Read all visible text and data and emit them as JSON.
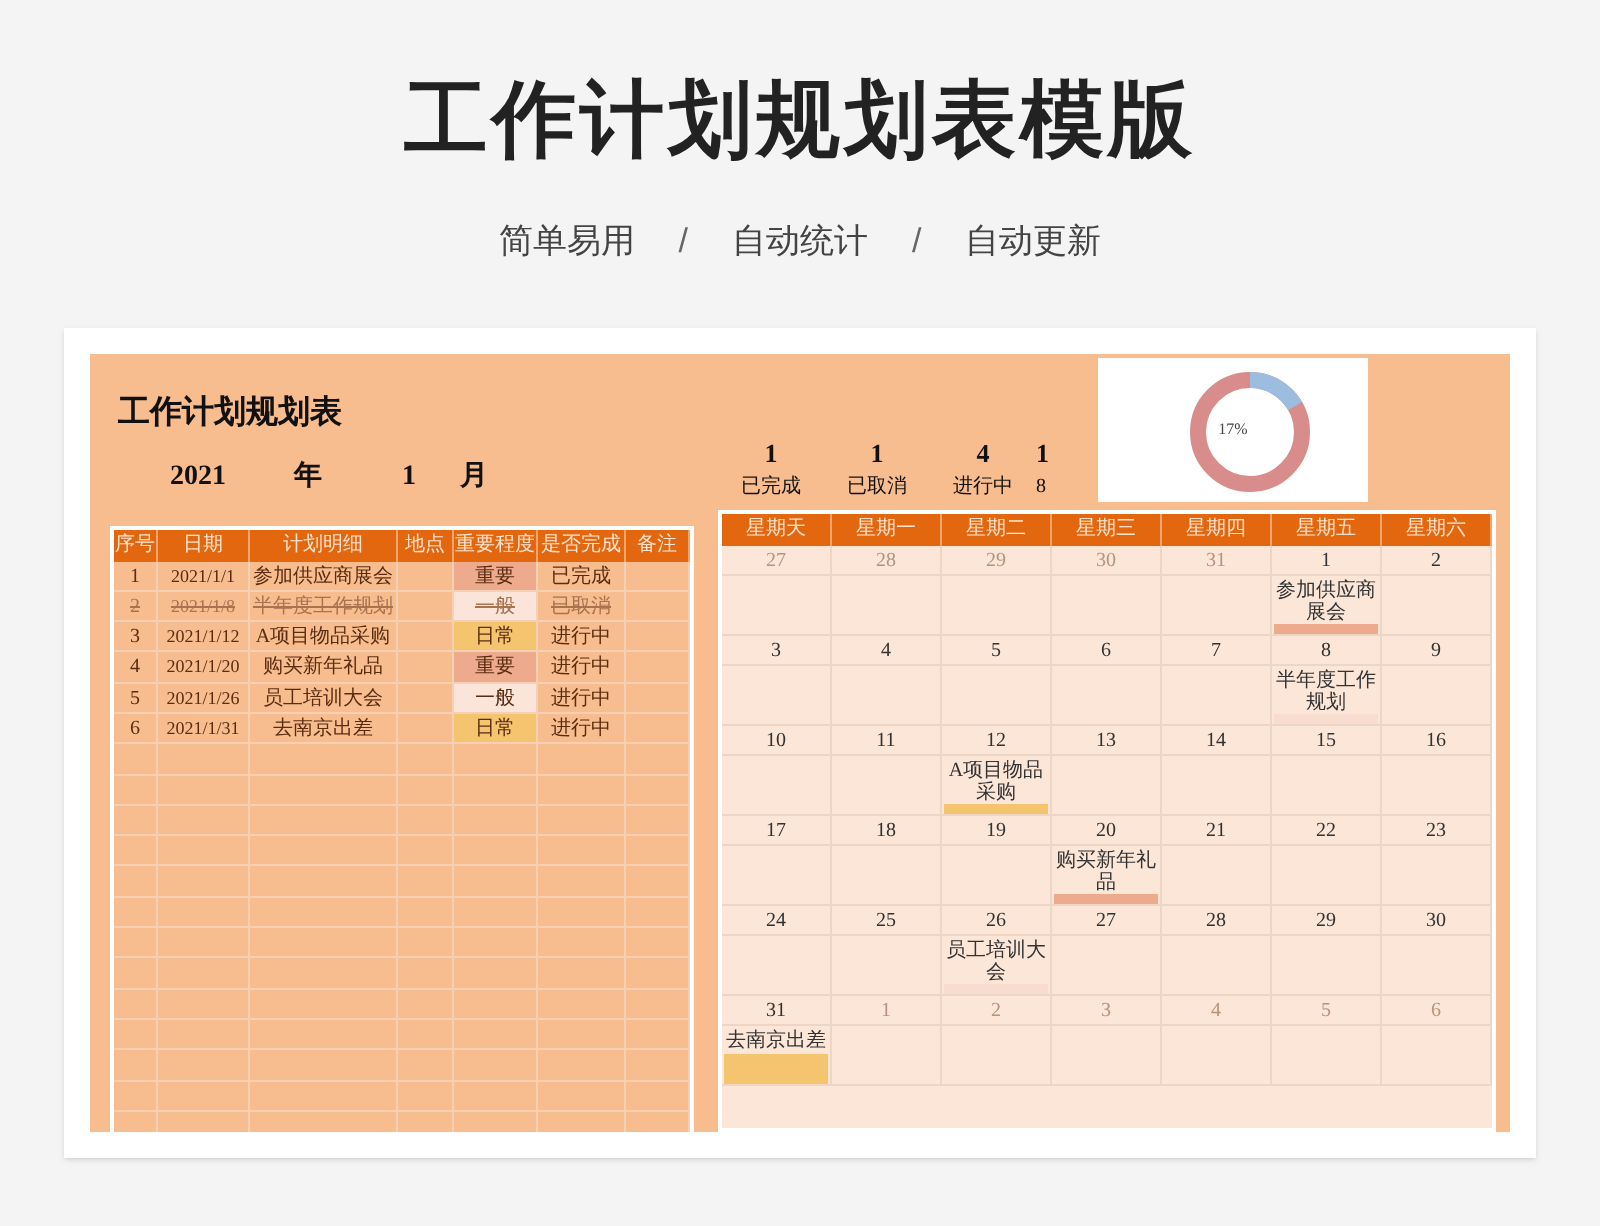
{
  "title": "工作计划规划表模版",
  "tags": [
    "简单易用",
    "/",
    "自动统计",
    "/",
    "自动更新"
  ],
  "sheet": {
    "title": "工作计划规划表",
    "year": "2021",
    "year_unit": "年",
    "month": "1",
    "month_unit": "月",
    "stats": [
      {
        "value": "1",
        "label": "已完成"
      },
      {
        "value": "1",
        "label": "已取消"
      },
      {
        "value": "4",
        "label": "进行中"
      },
      {
        "value": "1",
        "label": "8"
      }
    ],
    "donut_label": "17%",
    "table": {
      "columns": [
        "序号",
        "日期",
        "计划明细",
        "地点",
        "重要程度",
        "是否完成",
        "备注"
      ],
      "rows": [
        {
          "no": "1",
          "date": "2021/1/1",
          "task": "参加供应商展会",
          "importance": "重要",
          "color": "#eeaa8c",
          "status": "已完成",
          "cancelled": false
        },
        {
          "no": "2",
          "date": "2021/1/8",
          "task": "半年度工作规划",
          "importance": "一般",
          "color": "#fbe4da",
          "status": "已取消",
          "cancelled": true
        },
        {
          "no": "3",
          "date": "2021/1/12",
          "task": "A项目物品采购",
          "importance": "日常",
          "color": "#f4c46e",
          "status": "进行中",
          "cancelled": false
        },
        {
          "no": "4",
          "date": "2021/1/20",
          "task": "购买新年礼品",
          "importance": "重要",
          "color": "#eeaa8c",
          "status": "进行中",
          "cancelled": false
        },
        {
          "no": "5",
          "date": "2021/1/26",
          "task": "员工培训大会",
          "importance": "一般",
          "color": "#fbe4da",
          "status": "进行中",
          "cancelled": false
        },
        {
          "no": "6",
          "date": "2021/1/31",
          "task": "去南京出差",
          "importance": "日常",
          "color": "#f4c46e",
          "status": "进行中",
          "cancelled": false
        }
      ]
    },
    "calendar": {
      "weekdays": [
        "星期天",
        "星期一",
        "星期二",
        "星期三",
        "星期四",
        "星期五",
        "星期六"
      ],
      "weeks": [
        [
          {
            "day": "27",
            "muted": true
          },
          {
            "day": "28",
            "muted": true
          },
          {
            "day": "29",
            "muted": true
          },
          {
            "day": "30",
            "muted": true
          },
          {
            "day": "31",
            "muted": true
          },
          {
            "day": "1",
            "muted": false,
            "event": "参加供应商展会",
            "color": "#eeaa8c"
          },
          {
            "day": "2",
            "muted": false
          }
        ],
        [
          {
            "day": "3",
            "muted": false
          },
          {
            "day": "4",
            "muted": false
          },
          {
            "day": "5",
            "muted": false
          },
          {
            "day": "6",
            "muted": false
          },
          {
            "day": "7",
            "muted": false
          },
          {
            "day": "8",
            "muted": false,
            "event": "半年度工作规划",
            "color": "#f8dccf"
          },
          {
            "day": "9",
            "muted": false
          }
        ],
        [
          {
            "day": "10",
            "muted": false
          },
          {
            "day": "11",
            "muted": false
          },
          {
            "day": "12",
            "muted": false,
            "event": "A项目物品采购",
            "color": "#f4c46e"
          },
          {
            "day": "13",
            "muted": false
          },
          {
            "day": "14",
            "muted": false
          },
          {
            "day": "15",
            "muted": false
          },
          {
            "day": "16",
            "muted": false
          }
        ],
        [
          {
            "day": "17",
            "muted": false
          },
          {
            "day": "18",
            "muted": false
          },
          {
            "day": "19",
            "muted": false
          },
          {
            "day": "20",
            "muted": false,
            "event": "购买新年礼品",
            "color": "#eeaa8c"
          },
          {
            "day": "21",
            "muted": false
          },
          {
            "day": "22",
            "muted": false
          },
          {
            "day": "23",
            "muted": false
          }
        ],
        [
          {
            "day": "24",
            "muted": false
          },
          {
            "day": "25",
            "muted": false
          },
          {
            "day": "26",
            "muted": false,
            "event": "员工培训大会",
            "color": "#f8dccf"
          },
          {
            "day": "27",
            "muted": false
          },
          {
            "day": "28",
            "muted": false
          },
          {
            "day": "29",
            "muted": false
          },
          {
            "day": "30",
            "muted": false
          }
        ],
        [
          {
            "day": "31",
            "muted": false,
            "event": "去南京出差",
            "color": "#f4c46e"
          },
          {
            "day": "1",
            "muted": true
          },
          {
            "day": "2",
            "muted": true
          },
          {
            "day": "3",
            "muted": true
          },
          {
            "day": "4",
            "muted": true
          },
          {
            "day": "5",
            "muted": true
          },
          {
            "day": "6",
            "muted": true
          }
        ]
      ]
    }
  }
}
